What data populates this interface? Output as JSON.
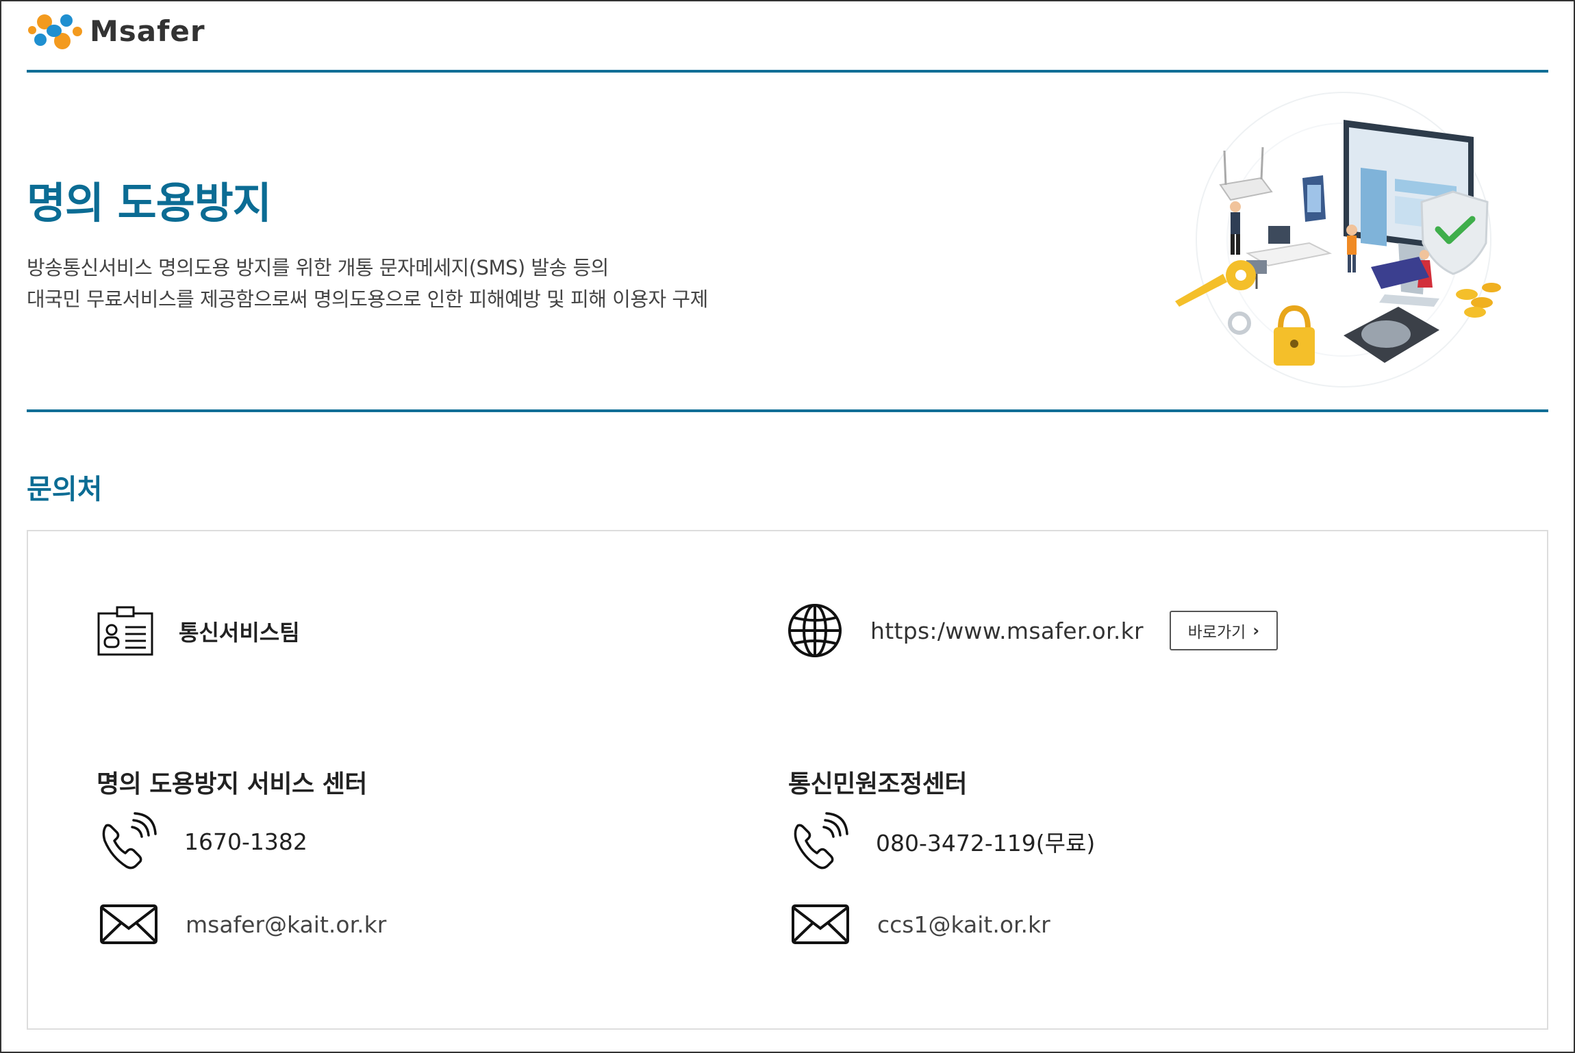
{
  "brand": {
    "name": "Msafer",
    "colors": {
      "accent": "#0b6c94",
      "rule": "#0f6e96",
      "logo_orange": "#f39a1e",
      "logo_blue": "#1f8fd0"
    }
  },
  "hero": {
    "title": "명의 도용방지",
    "description_line1": "방송통신서비스 명의도용 방지를 위한 개통 문자메세지(SMS) 발송 등의",
    "description_line2": "대국민 무료서비스를 제공함으로써 명의도용으로 인한 피해예방 및 피해 이용자 구제",
    "illustration": "security-illustration"
  },
  "contact": {
    "section_title": "문의처",
    "team": {
      "icon": "id-card-icon",
      "label": "통신서비스팀"
    },
    "website": {
      "icon": "globe-icon",
      "url": "https:/www.msafer.or.kr",
      "button_label": "바로가기",
      "button_icon": "chevron-right-icon"
    },
    "centers": [
      {
        "title": "명의 도용방지 서비스 센터",
        "phone_icon": "phone-icon",
        "phone": "1670-1382",
        "mail_icon": "mail-icon",
        "email": "msafer@kait.or.kr"
      },
      {
        "title": "통신민원조정센터",
        "phone_icon": "phone-icon",
        "phone": "080-3472-119(무료)",
        "mail_icon": "mail-icon",
        "email": "ccs1@kait.or.kr"
      }
    ]
  }
}
